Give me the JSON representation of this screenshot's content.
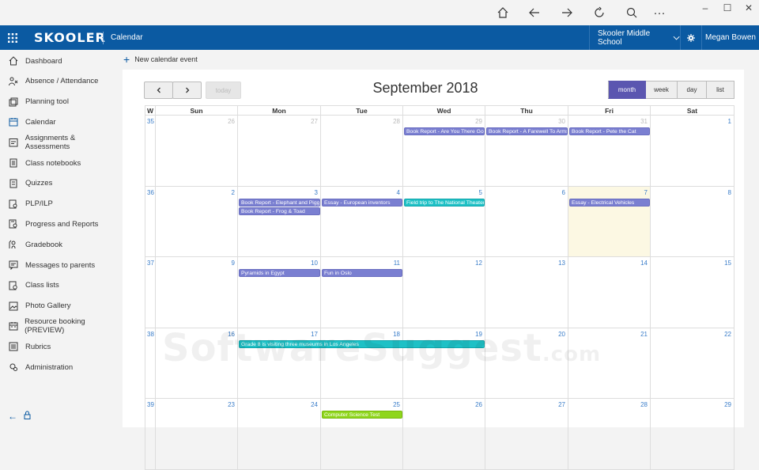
{
  "browser": {
    "icons": [
      "home-icon",
      "back-icon",
      "forward-icon",
      "refresh-icon",
      "search-icon",
      "more-icon"
    ],
    "more_label": "···"
  },
  "window": {
    "minimize": "–",
    "maximize": "☐",
    "close": "✕"
  },
  "appbar": {
    "logo": "SKOOLER",
    "section": "Calendar",
    "school": "Skooler Middle School",
    "user": "Megan Bowen",
    "bg_color": "#0b5aa2"
  },
  "sidebar": {
    "items": [
      {
        "label": "Dashboard",
        "icon": "home-icon"
      },
      {
        "label": "Absence / Attendance",
        "icon": "attendance-icon"
      },
      {
        "label": "Planning tool",
        "icon": "planning-icon"
      },
      {
        "label": "Calendar",
        "icon": "calendar-icon"
      },
      {
        "label": "Assignments & Assessments",
        "icon": "assignments-icon"
      },
      {
        "label": "Class notebooks",
        "icon": "notebook-icon"
      },
      {
        "label": "Quizzes",
        "icon": "quiz-icon"
      },
      {
        "label": "PLP/ILP",
        "icon": "plp-icon"
      },
      {
        "label": "Progress and Reports",
        "icon": "reports-icon"
      },
      {
        "label": "Gradebook",
        "icon": "gradebook-icon"
      },
      {
        "label": "Messages to parents",
        "icon": "message-icon"
      },
      {
        "label": "Class lists",
        "icon": "classlist-icon"
      },
      {
        "label": "Photo Gallery",
        "icon": "photo-icon"
      },
      {
        "label": "Resource booking (PREVIEW)",
        "icon": "booking-icon"
      },
      {
        "label": "Rubrics",
        "icon": "rubrics-icon"
      },
      {
        "label": "Administration",
        "icon": "admin-icon"
      }
    ],
    "footer_back": "←",
    "footer_lock": "lock-icon"
  },
  "commandbar": {
    "new_event": "New calendar event"
  },
  "calendar": {
    "title": "September 2018",
    "today_label": "today",
    "prev": "‹",
    "next": "›",
    "views": [
      "month",
      "week",
      "day",
      "list"
    ],
    "active_view": "month",
    "headers": [
      "W",
      "Sun",
      "Mon",
      "Tue",
      "Wed",
      "Thu",
      "Fri",
      "Sat"
    ],
    "weeks": [
      {
        "wk": "35",
        "days": [
          "26",
          "27",
          "28",
          "29",
          "30",
          "31",
          "1"
        ],
        "current": [
          false,
          false,
          false,
          false,
          false,
          false,
          true
        ]
      },
      {
        "wk": "36",
        "days": [
          "2",
          "3",
          "4",
          "5",
          "6",
          "7",
          "8"
        ],
        "current": [
          true,
          true,
          true,
          true,
          true,
          true,
          true
        ]
      },
      {
        "wk": "37",
        "days": [
          "9",
          "10",
          "11",
          "12",
          "13",
          "14",
          "15"
        ],
        "current": [
          true,
          true,
          true,
          true,
          true,
          true,
          true
        ]
      },
      {
        "wk": "38",
        "days": [
          "16",
          "17",
          "18",
          "19",
          "20",
          "21",
          "22"
        ],
        "current": [
          true,
          true,
          true,
          true,
          true,
          true,
          true
        ]
      },
      {
        "wk": "39",
        "days": [
          "23",
          "24",
          "25",
          "26",
          "27",
          "28",
          "29"
        ],
        "current": [
          true,
          true,
          true,
          true,
          true,
          true,
          true
        ]
      }
    ],
    "today": {
      "week": 1,
      "day": 5
    },
    "events": [
      {
        "title": "Book Report - Are You There God",
        "week": 0,
        "day": 3,
        "span": 1,
        "slot": 0,
        "color": "purple"
      },
      {
        "title": "Book Report - A Farewell To Arms",
        "week": 0,
        "day": 4,
        "span": 1,
        "slot": 0,
        "color": "purple"
      },
      {
        "title": "Book Report - Pete the Cat",
        "week": 0,
        "day": 5,
        "span": 1,
        "slot": 0,
        "color": "purple"
      },
      {
        "title": "Book Report - Elephant and Piggie",
        "week": 1,
        "day": 1,
        "span": 1,
        "slot": 0,
        "color": "purple"
      },
      {
        "title": "Book Report - Frog & Toad",
        "week": 1,
        "day": 1,
        "span": 1,
        "slot": 1,
        "color": "purple"
      },
      {
        "title": "Essay - European inventors",
        "week": 1,
        "day": 2,
        "span": 1,
        "slot": 0,
        "color": "purple"
      },
      {
        "title": "Field trip to The National Theater",
        "week": 1,
        "day": 3,
        "span": 1,
        "slot": 0,
        "color": "teal"
      },
      {
        "title": "Essay - Electrical Vehicles",
        "week": 1,
        "day": 5,
        "span": 1,
        "slot": 0,
        "color": "purple"
      },
      {
        "title": "Pyramids in Egypt",
        "week": 2,
        "day": 1,
        "span": 1,
        "slot": 0,
        "color": "purple"
      },
      {
        "title": "Fun in Oslo",
        "week": 2,
        "day": 2,
        "span": 1,
        "slot": 0,
        "color": "purple"
      },
      {
        "title": "Grade 8 is visiting three museums in Los Angeles",
        "week": 3,
        "day": 1,
        "span": 3,
        "slot": 0,
        "color": "teal"
      },
      {
        "title": "Computer Science Test",
        "week": 4,
        "day": 2,
        "span": 1,
        "slot": 0,
        "color": "green"
      }
    ]
  },
  "watermark": {
    "main": "SoftwareSuggest",
    "suffix": ".com"
  }
}
